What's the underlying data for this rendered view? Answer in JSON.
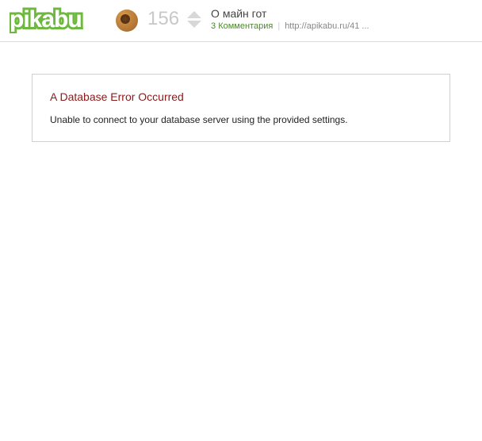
{
  "logo": {
    "text": "pikabu",
    "icon_name": "cookie-icon"
  },
  "post": {
    "rating": "156",
    "title": "О майн гот",
    "comments_label": "3 Комментария",
    "url": "http://apikabu.ru/41 ..."
  },
  "error": {
    "title": "A Database Error Occurred",
    "message": "Unable to connect to your database server using the provided settings."
  }
}
